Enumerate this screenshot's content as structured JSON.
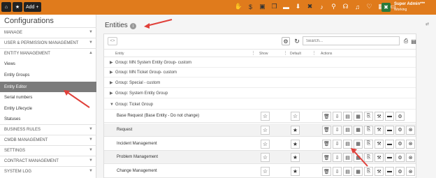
{
  "topbar": {
    "home_icon": "home-icon",
    "star_icon": "star-icon",
    "add_label": "Add +",
    "icons": [
      "hand-icon",
      "dollar-icon",
      "id-card-icon",
      "gift-icon",
      "flag-icon",
      "download-icon",
      "x-icon",
      "bell-icon",
      "search-icon",
      "headset-icon",
      "bell-icon",
      "heart-icon",
      "calendar-icon",
      "folder-icon"
    ],
    "user": {
      "name": "Super Admin***",
      "status": "Working",
      "avatar": "x-icon"
    }
  },
  "sidebar": {
    "title": "Configurations",
    "sections": [
      {
        "label": "MANAGE",
        "expanded": false
      },
      {
        "label": "USER & PERMISSION MANAGEMENT",
        "expanded": false
      },
      {
        "label": "ENTITY MANAGEMENT",
        "expanded": true
      }
    ],
    "entity_items": [
      "Views",
      "Entity Groups",
      "Entity Editor",
      "Serial numbers",
      "Entity Lifecycle",
      "Statuses"
    ],
    "active_item": "Entity Editor",
    "bottom_sections": [
      "BUSINESS RULES",
      "CMDB MANAGEMENT",
      "SETTINGS",
      "CONTRACT MANAGEMENT",
      "SYSTEM LOG"
    ]
  },
  "main": {
    "title": "Entities",
    "corner": "⇄",
    "search": {
      "placeholder": "Search..."
    },
    "columns": {
      "entity": "Entity",
      "show": "Show",
      "default": "Default",
      "actions": "Actions"
    },
    "groups": [
      {
        "label": "Group: MN System Entity Group- custom",
        "expanded": false
      },
      {
        "label": "Group: MN Ticket Group- custom",
        "expanded": false
      },
      {
        "label": "Group: Special - custom",
        "expanded": false
      },
      {
        "label": "Group: System Entity Group",
        "expanded": false
      },
      {
        "label": "Group: Ticket Group",
        "expanded": true
      }
    ],
    "rows": [
      {
        "name": "Base Request (Base Entity - Do not change)",
        "show": "☆",
        "default": "☆",
        "acts": [
          "🗑",
          "⇩",
          "▤",
          "▦",
          "⎘",
          "⚒",
          "▬",
          "⚙"
        ]
      },
      {
        "name": "Request",
        "show": "☆",
        "default": "★",
        "acts": [
          "🗑",
          "⇩",
          "▤",
          "▦",
          "⎘",
          "⚒",
          "▬",
          "⚙",
          "⊗"
        ]
      },
      {
        "name": "Incident Management",
        "show": "☆",
        "default": "★",
        "acts": [
          "🗑",
          "⇩",
          "▤",
          "▦",
          "⎘",
          "⚒",
          "▬",
          "⚙",
          "⊗"
        ]
      },
      {
        "name": "Problem Management",
        "show": "☆",
        "default": "★",
        "acts": [
          "🗑",
          "⇩",
          "▤",
          "▦",
          "⎘",
          "⚒",
          "▬",
          "⚙",
          "⊗"
        ]
      },
      {
        "name": "Change Management",
        "show": "☆",
        "default": "★",
        "acts": [
          "🗑",
          "⇩",
          "▤",
          "▦",
          "⎘",
          "⚒",
          "▬",
          "⚙",
          "⊗"
        ]
      }
    ]
  },
  "colors": {
    "topbar": "#e07b1c",
    "active_item": "#7b7b7b",
    "arrow": "#e0403a"
  }
}
